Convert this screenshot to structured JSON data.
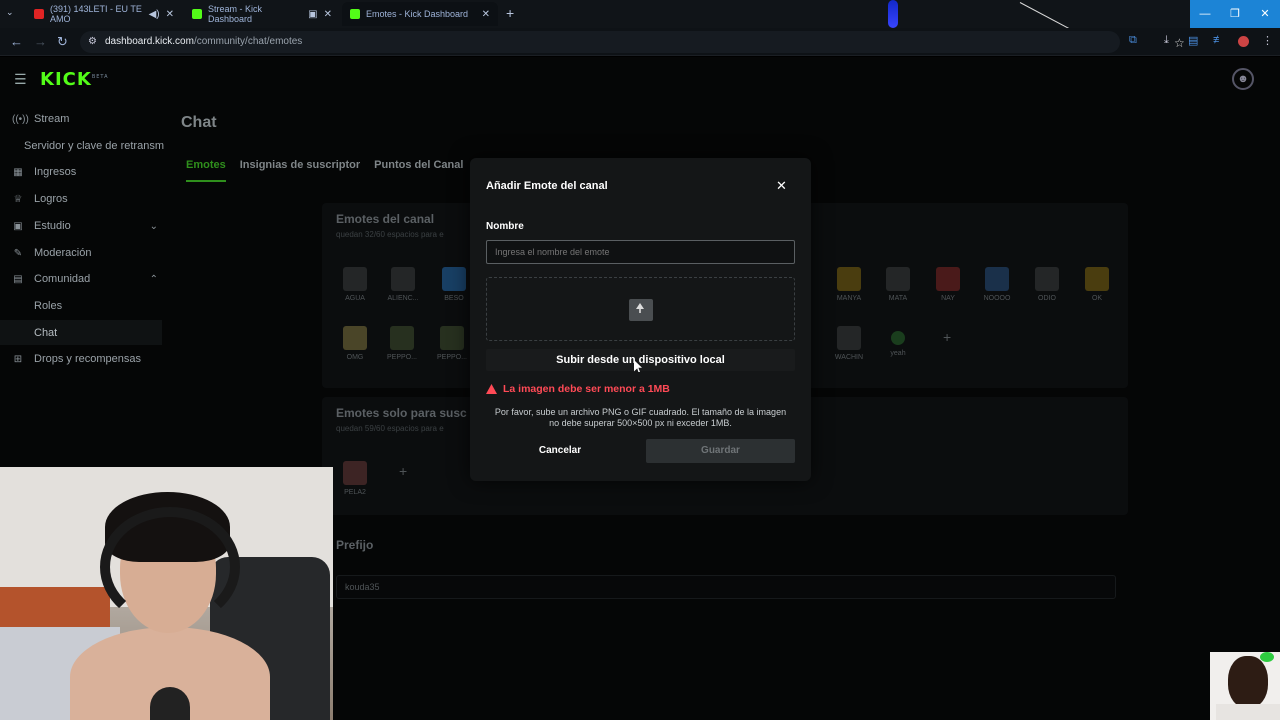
{
  "browser": {
    "tabs": [
      {
        "title": "(391) 143LETI - EU TE AMO",
        "favicon_color": "#e02424"
      },
      {
        "title": "Stream - Kick Dashboard",
        "favicon_color": "#53fc18"
      },
      {
        "title": "Emotes - Kick Dashboard",
        "favicon_color": "#53fc18"
      }
    ],
    "url_host": "dashboard.kick.com",
    "url_path": "/community/chat/emotes"
  },
  "app": {
    "logo": "KICK",
    "logo_badge": "BETA",
    "sidebar": {
      "stream": "Stream",
      "server": "Servidor y clave de retransm",
      "ingresos": "Ingresos",
      "logros": "Logros",
      "estudio": "Estudio",
      "moderacion": "Moderación",
      "comunidad": "Comunidad",
      "roles": "Roles",
      "chat": "Chat",
      "drops": "Drops y recompensas"
    },
    "page_title": "Chat",
    "tabs": [
      "Emotes",
      "Insignias de suscriptor",
      "Puntos del Canal"
    ],
    "channel_emotes": {
      "title": "Emotes del canal",
      "subtitle": "quedan 32/60 espacios para e",
      "row1_left": [
        "AGUA",
        "ALIENC...",
        "BESO"
      ],
      "row1_right": [
        "MANYA",
        "MATA",
        "NAY",
        "NOOOO",
        "ODIO",
        "OK"
      ],
      "row2_left": [
        "OMG",
        "PEPPO...",
        "PEPPO..."
      ],
      "row2_right": [
        "WACHIN",
        "yeah"
      ]
    },
    "sub_emotes": {
      "title": "Emotes solo para susc",
      "subtitle": "quedan 59/60 espacios para e",
      "items": [
        "PELA2"
      ]
    },
    "prefix": {
      "title": "Prefijo",
      "value": "kouda35"
    }
  },
  "modal": {
    "title": "Añadir Emote del canal",
    "name_label": "Nombre",
    "name_placeholder": "Ingresa el nombre del emote",
    "upload_button": "Subir desde un dispositivo local",
    "error": "La imagen debe ser menor a 1MB",
    "help": "Por favor, sube un archivo PNG o GIF cuadrado. El tamaño de la imagen no debe superar 500×500 px ni exceder 1MB.",
    "cancel": "Cancelar",
    "save": "Guardar"
  },
  "colors": {
    "accent": "#53fc18",
    "error": "#ff4a56"
  }
}
